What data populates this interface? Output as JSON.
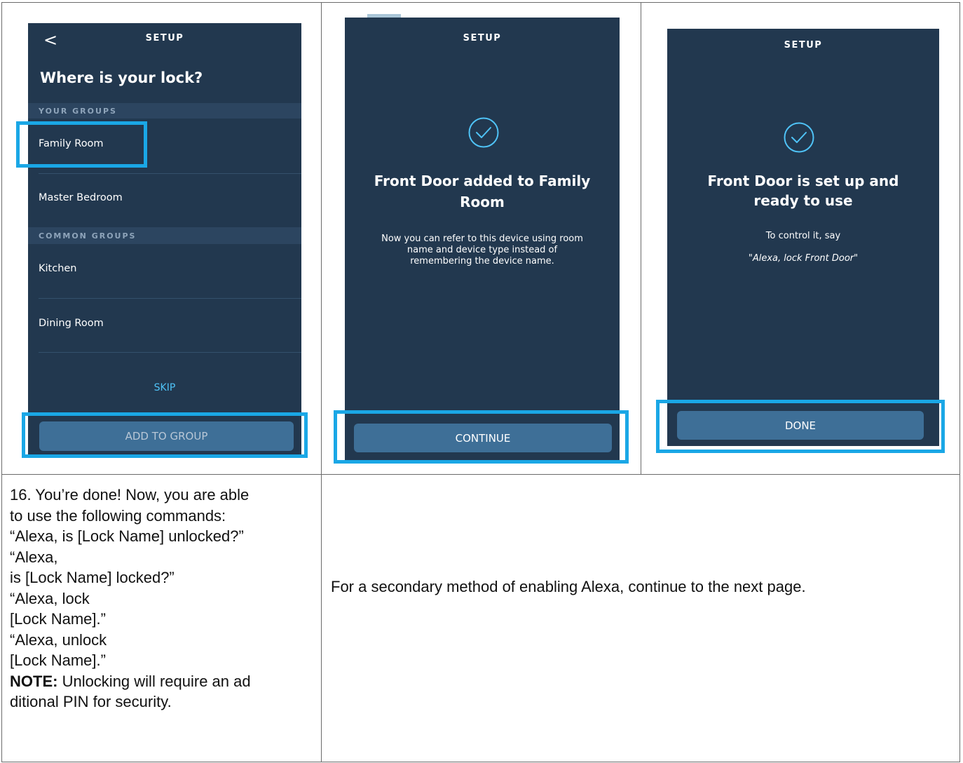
{
  "panel1": {
    "header": "SETUP",
    "back_label": "<",
    "title": "Where is your lock?",
    "your_groups_label": "YOUR GROUPS",
    "your_groups": [
      "Family Room",
      "Master Bedroom"
    ],
    "common_groups_label": "COMMON GROUPS",
    "common_groups": [
      "Kitchen",
      "Dining Room"
    ],
    "skip_label": "SKIP",
    "primary_button": "ADD TO GROUP"
  },
  "panel2": {
    "header": "SETUP",
    "icon": "check-circle-icon",
    "title_line1": "Front Door added to Family",
    "title_line2": "Room",
    "body_line1": "Now you can refer to this device using room",
    "body_line2": "name and device type instead of",
    "body_line3": "remembering the device name.",
    "primary_button": "CONTINUE"
  },
  "panel3": {
    "header": "SETUP",
    "icon": "check-circle-icon",
    "title_line1": "Front Door is set up and",
    "title_line2": "ready to use",
    "body": "To control it, say",
    "example": "\"Alexa, lock Front Door\"",
    "primary_button": "DONE"
  },
  "step16": {
    "lines": [
      "16. You’re done! Now, you are able",
      "to use the following commands:",
      "“Alexa, is [Lock Name] unlocked?”",
      "“Alexa,",
      "is [Lock Name] locked?”",
      "“Alexa, lock",
      "[Lock Name].”",
      "“Alexa, unlock",
      "[Lock Name].”"
    ],
    "note_label": "NOTE:",
    "note_line1": " Unlocking will require an ad",
    "note_line2": "ditional PIN for security."
  },
  "secondary_note": "For a secondary method of enabling Alexa, continue to the next page.",
  "colors": {
    "screen_bg": "#22384f",
    "section_band": "#2c4560",
    "button": "#3e6f97",
    "highlight": "#1aa7e6",
    "link": "#4fc3f7"
  }
}
